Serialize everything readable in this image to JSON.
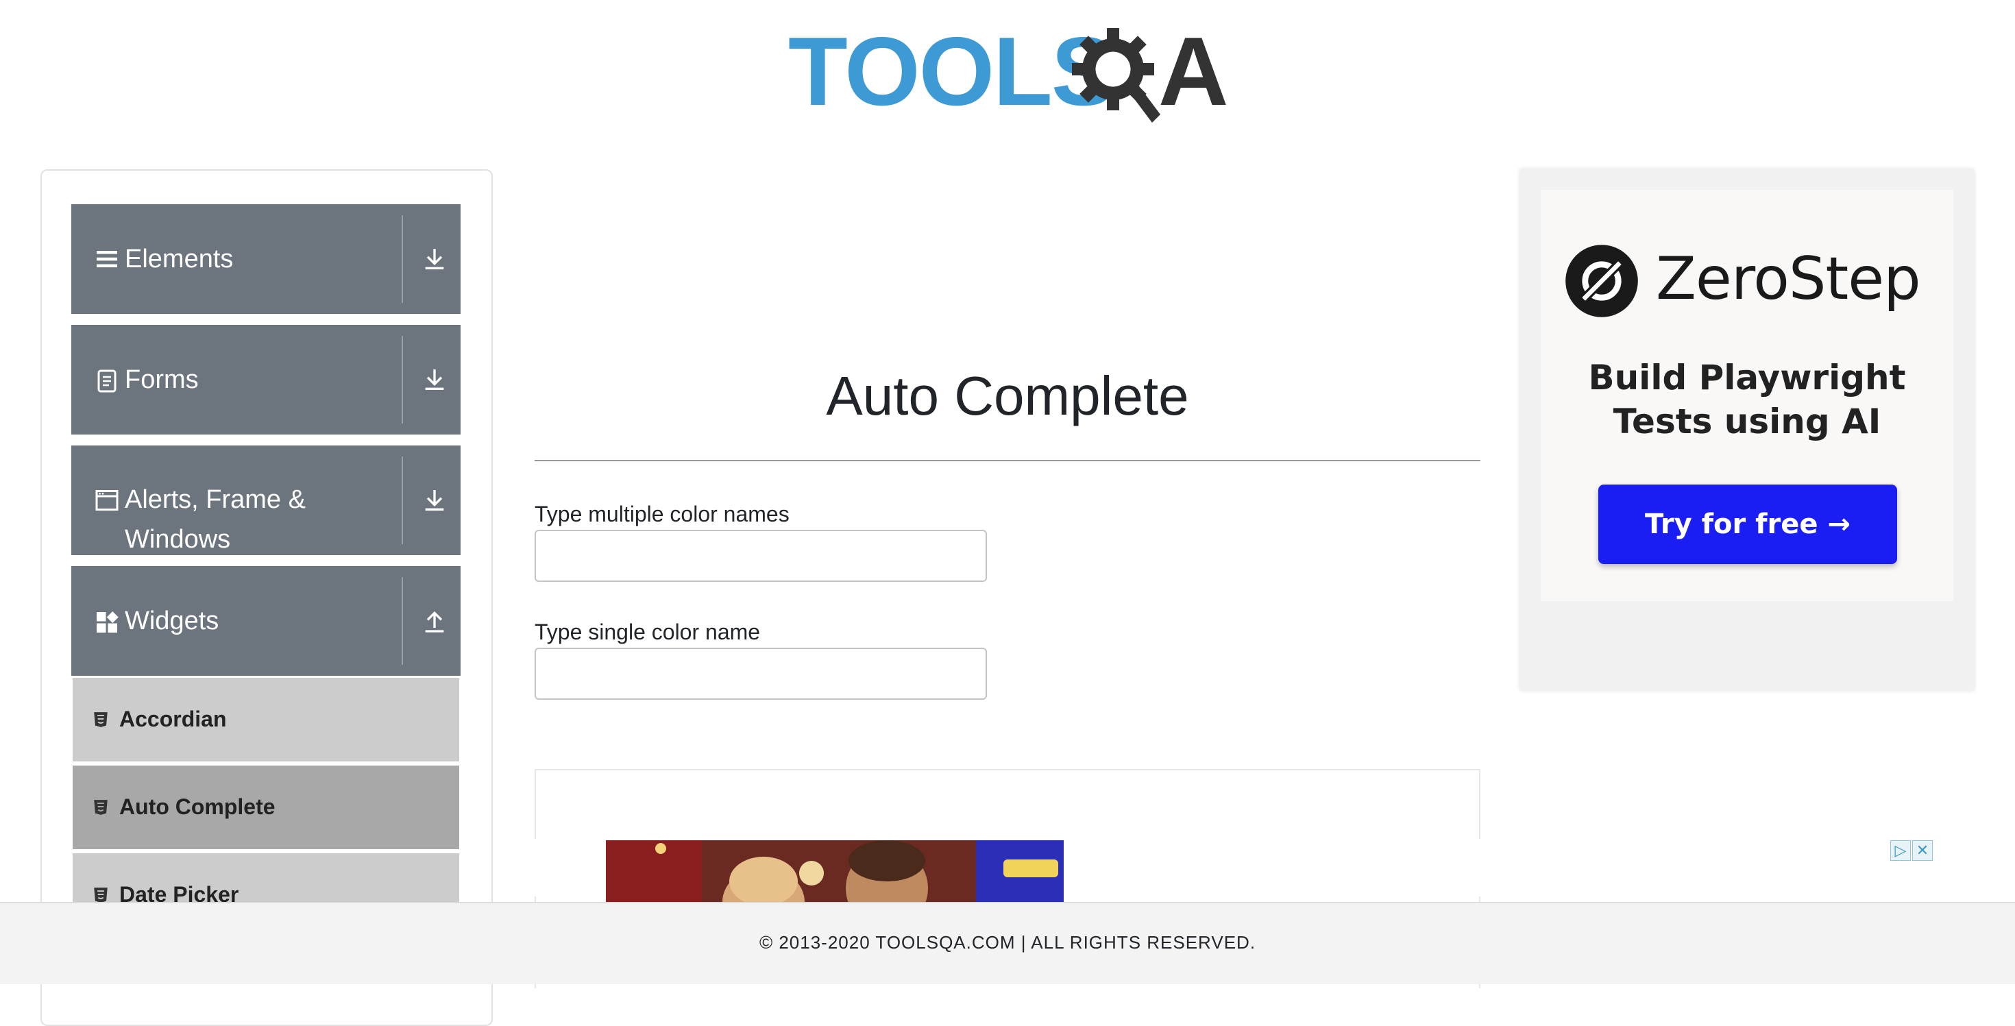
{
  "logo": {
    "tools_text": "TOOLS",
    "a_text": "A",
    "colors": {
      "tools": "#3d9ad4",
      "qa": "#333333"
    }
  },
  "sidebar": {
    "groups": [
      {
        "label": "Elements",
        "icon": "hamburger-icon",
        "arrow": "download-icon"
      },
      {
        "label": "Forms",
        "icon": "document-icon",
        "arrow": "download-icon"
      },
      {
        "label": "Alerts, Frame &",
        "label_line2": "Windows",
        "icon": "window-icon",
        "arrow": "download-icon"
      },
      {
        "label": "Widgets",
        "icon": "widgets-icon",
        "arrow": "upload-icon"
      }
    ],
    "items": [
      {
        "label": "Accordian",
        "icon": "html5-icon"
      },
      {
        "label": "Auto Complete",
        "icon": "html5-icon",
        "active": true
      },
      {
        "label": "Date Picker",
        "icon": "html5-icon"
      }
    ],
    "colors": {
      "group_bg": "#6c757d",
      "item_bg": "#cccccc",
      "item_active_bg": "#a8a8a8"
    }
  },
  "main": {
    "title": "Auto Complete",
    "fields": [
      {
        "label": "Type multiple color names",
        "value": "",
        "placeholder": ""
      },
      {
        "label": "Type single color name",
        "value": "",
        "placeholder": ""
      }
    ]
  },
  "ad_right": {
    "brand": "ZeroStep",
    "tagline_line1": "Build Playwright",
    "tagline_line2": "Tests using AI",
    "button": "Try for free →",
    "button_color": "#1b1ef2"
  },
  "ad_bottom": {
    "controls": [
      "▷",
      "✕"
    ]
  },
  "footer": {
    "text": "© 2013-2020 TOOLSQA.COM | ALL RIGHTS RESERVED."
  }
}
